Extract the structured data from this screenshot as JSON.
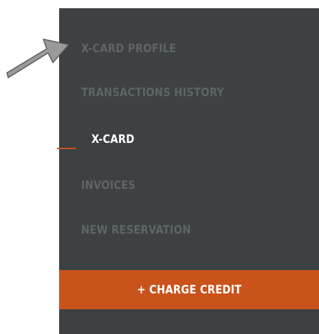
{
  "sidebar": {
    "items": [
      {
        "label": "X-CARD PROFILE",
        "active": false
      },
      {
        "label": "TRANSACTIONS HISTORY",
        "active": false
      },
      {
        "label": "X-CARD",
        "active": true
      },
      {
        "label": "INVOICES",
        "active": false
      },
      {
        "label": "NEW RESERVATION",
        "active": false
      }
    ],
    "charge_button_label": "+ CHARGE CREDIT"
  },
  "colors": {
    "sidebar_background": "#3d4143",
    "inactive_text": "#5e6466",
    "active_text": "#ffffff",
    "accent": "#c9531b",
    "annotation_arrow": "#9a9a9a"
  },
  "annotation": {
    "icon": "pointer-arrow-icon"
  }
}
